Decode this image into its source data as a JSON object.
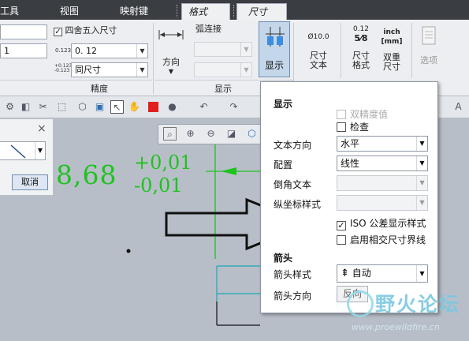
{
  "tabs": [
    {
      "label": "工具",
      "active": false
    },
    {
      "label": "视图",
      "active": false
    },
    {
      "label": "映射键",
      "active": false
    },
    {
      "label": "格式",
      "active": true
    },
    {
      "label": "尺寸",
      "active": true
    }
  ],
  "ribbon": {
    "round_checkbox": {
      "label": "四舍五入尺寸",
      "checked": true
    },
    "field_top": "",
    "field_second": "1",
    "tolerance_value": "0. 12",
    "tolerance_mode": "同尺寸",
    "precision_group": "精度",
    "arc_connect_label": "弧连接",
    "direction_label": "方向",
    "display_group": "显示",
    "display_button": "显示",
    "dim_text_button": [
      "尺寸",
      "文本"
    ],
    "dim_format_button": [
      "尺寸",
      "格式"
    ],
    "dual_dim_button": [
      "双重",
      "尺寸"
    ],
    "options_button": "选项",
    "icon_text_small": "Ø10.0",
    "icon_text_fraction": "0.12",
    "icon_text_frac_result": "5⁄8",
    "icon_text_inch": "inch",
    "icon_text_mm": "[mm]",
    "precision_icon_a": "0.123",
    "precision_icon_b": "+0.123",
    "precision_icon_c": "-0.123"
  },
  "leftpanel": {
    "close": "×",
    "cancel_label": "取消"
  },
  "canvas": {
    "dim_main": "8,68",
    "tol_plus": "+0,01",
    "tol_minus": "-0,01"
  },
  "popup": {
    "section_display": "显示",
    "double_precision": "双精度值",
    "inspect": "检查",
    "text_direction_label": "文本方向",
    "text_direction_value": "水平",
    "config_label": "配置",
    "config_value": "线性",
    "chamfer_text_label": "倒角文本",
    "ordinate_style_label": "纵坐标样式",
    "iso_tolerance": "ISO 公差显示样式",
    "enable_intersect": "启用相交尺寸界线",
    "section_arrow": "箭头",
    "arrow_style_label": "箭头样式",
    "arrow_style_value": "自动",
    "arrow_dir_label": "箭头方向",
    "arrow_dir_button": "反向",
    "iso_checked": true,
    "inspect_checked": false,
    "double_precision_checked": false,
    "enable_intersect_checked": false
  },
  "watermark": {
    "title": "野火论坛",
    "url": "www.proewildfire.cn"
  },
  "colors": {
    "dimension_green": "#1ec31e",
    "accent_blue": "#2a6fb8",
    "cyan_line": "#1aa8b8"
  }
}
